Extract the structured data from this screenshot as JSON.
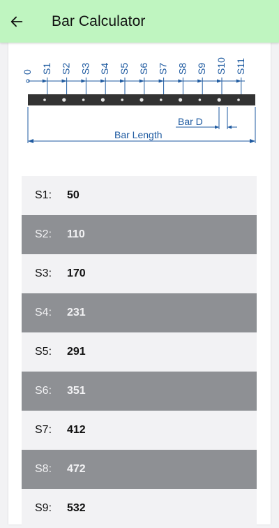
{
  "header": {
    "title": "Bar Calculator",
    "back_icon": "arrow-left-icon"
  },
  "diagram": {
    "zero_label": "0",
    "stations": [
      "S1",
      "S2",
      "S3",
      "S4",
      "S5",
      "S6",
      "S7",
      "S8",
      "S9",
      "S10",
      "S11"
    ],
    "bar_d_label": "Bar D",
    "bar_length_label": "Bar Length",
    "accent_color": "#1e5aa0",
    "bar_color": "#333333"
  },
  "results": [
    {
      "label": "S1:",
      "value": "50"
    },
    {
      "label": "S2:",
      "value": "110"
    },
    {
      "label": "S3:",
      "value": "170"
    },
    {
      "label": "S4:",
      "value": "231"
    },
    {
      "label": "S5:",
      "value": "291"
    },
    {
      "label": "S6:",
      "value": "351"
    },
    {
      "label": "S7:",
      "value": "412"
    },
    {
      "label": "S8:",
      "value": "472"
    },
    {
      "label": "S9:",
      "value": "532"
    }
  ]
}
